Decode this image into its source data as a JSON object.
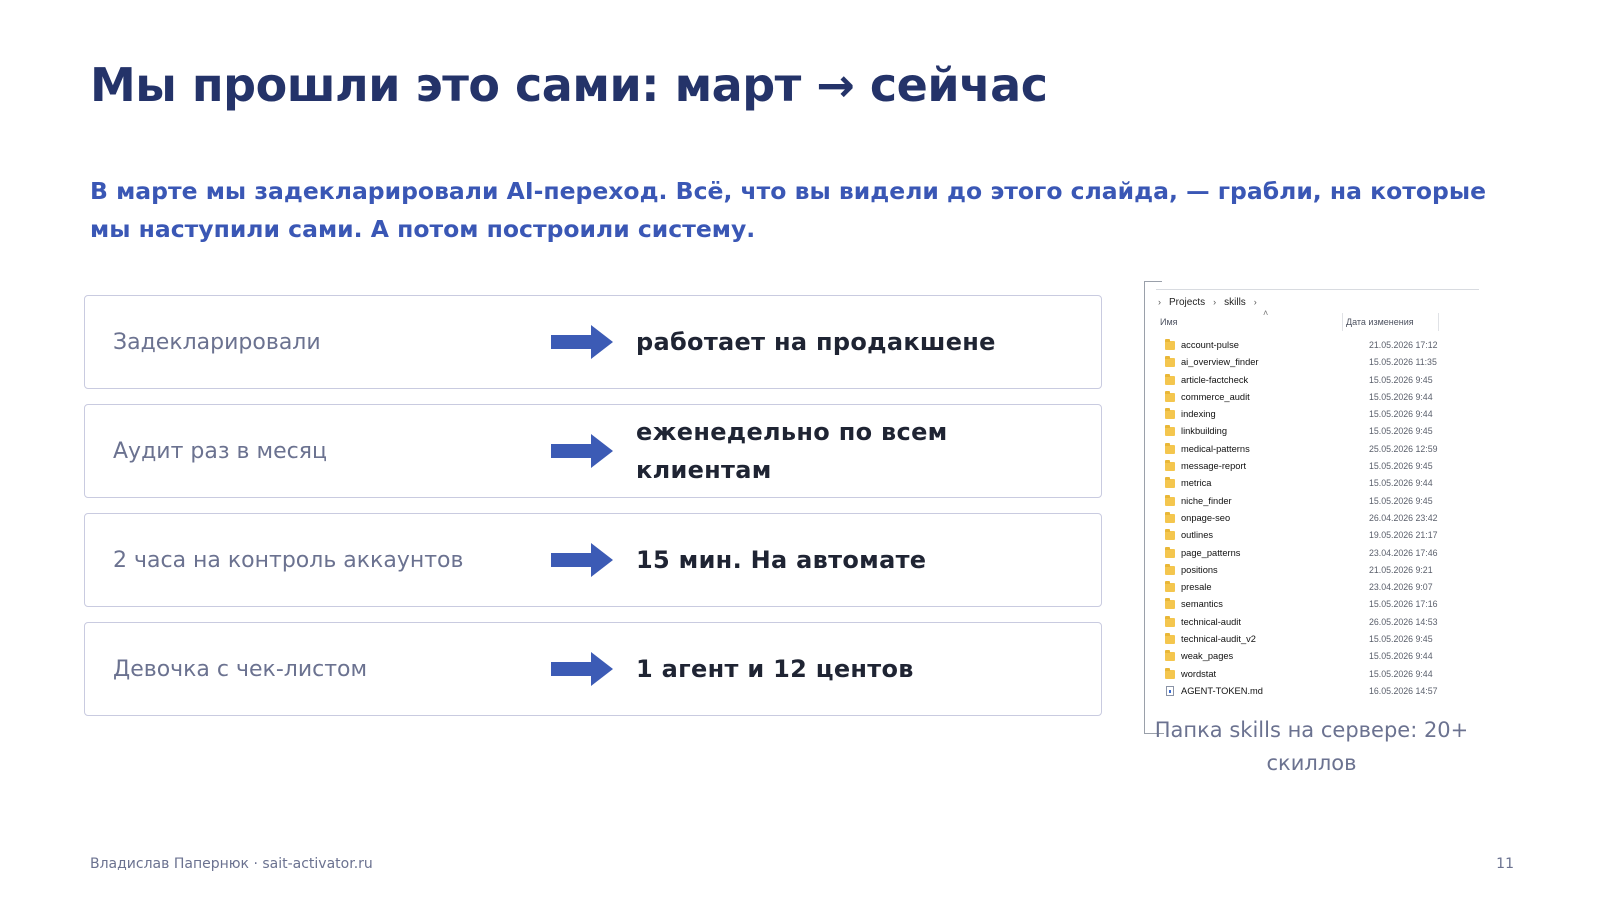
{
  "slide": {
    "title": "Мы прошли это сами: март → сейчас",
    "subtitle": "В марте мы задекларировали AI-переход. Всё, что вы видели до этого слайда, — грабли, на которые мы наступили сами. А потом построили систему."
  },
  "comparison": {
    "rows": [
      {
        "before": "Задекларировали",
        "after": "работает на продакшене"
      },
      {
        "before": "Аудит раз в месяц",
        "after": "еженедельно по всем клиентам"
      },
      {
        "before": "2 часа на контроль аккаунтов",
        "after": "15 мин. На автомате"
      },
      {
        "before": "Девочка с чек-листом",
        "after": "1  агент и 12 центов"
      }
    ],
    "arrow_icon": "arrow-right-icon",
    "arrow_color": "#3c5bb5"
  },
  "explorer": {
    "breadcrumb": [
      "Projects",
      "skills"
    ],
    "columns": {
      "name": "Имя",
      "modified": "Дата изменения"
    },
    "items": [
      {
        "type": "folder",
        "name": "account-pulse",
        "date": "21.05.2026 17:12"
      },
      {
        "type": "folder",
        "name": "ai_overview_finder",
        "date": "15.05.2026 11:35"
      },
      {
        "type": "folder",
        "name": "article-factcheck",
        "date": "15.05.2026 9:45"
      },
      {
        "type": "folder",
        "name": "commerce_audit",
        "date": "15.05.2026 9:44"
      },
      {
        "type": "folder",
        "name": "indexing",
        "date": "15.05.2026 9:44"
      },
      {
        "type": "folder",
        "name": "linkbuilding",
        "date": "15.05.2026 9:45"
      },
      {
        "type": "folder",
        "name": "medical-patterns",
        "date": "25.05.2026 12:59"
      },
      {
        "type": "folder",
        "name": "message-report",
        "date": "15.05.2026 9:45"
      },
      {
        "type": "folder",
        "name": "metrica",
        "date": "15.05.2026 9:44"
      },
      {
        "type": "folder",
        "name": "niche_finder",
        "date": "15.05.2026 9:45"
      },
      {
        "type": "folder",
        "name": "onpage-seo",
        "date": "26.04.2026 23:42"
      },
      {
        "type": "folder",
        "name": "outlines",
        "date": "19.05.2026 21:17"
      },
      {
        "type": "folder",
        "name": "page_patterns",
        "date": "23.04.2026 17:46"
      },
      {
        "type": "folder",
        "name": "positions",
        "date": "21.05.2026 9:21"
      },
      {
        "type": "folder",
        "name": "presale",
        "date": "23.04.2026 9:07"
      },
      {
        "type": "folder",
        "name": "semantics",
        "date": "15.05.2026 17:16"
      },
      {
        "type": "folder",
        "name": "technical-audit",
        "date": "26.05.2026 14:53"
      },
      {
        "type": "folder",
        "name": "technical-audit_v2",
        "date": "15.05.2026 9:45"
      },
      {
        "type": "folder",
        "name": "weak_pages",
        "date": "15.05.2026 9:44"
      },
      {
        "type": "folder",
        "name": "wordstat",
        "date": "15.05.2026 9:44"
      },
      {
        "type": "file",
        "name": "AGENT-TOKEN.md",
        "date": "16.05.2026 14:57"
      }
    ],
    "caption": "Папка skills на сервере: 20+ скиллов"
  },
  "footer": {
    "author": "Владислав Папернюк · sait-activator.ru",
    "page_number": "11"
  },
  "colors": {
    "title": "#243369",
    "subtitle": "#3a57b5",
    "muted": "#6b7290",
    "accent": "#3c5bb5"
  }
}
